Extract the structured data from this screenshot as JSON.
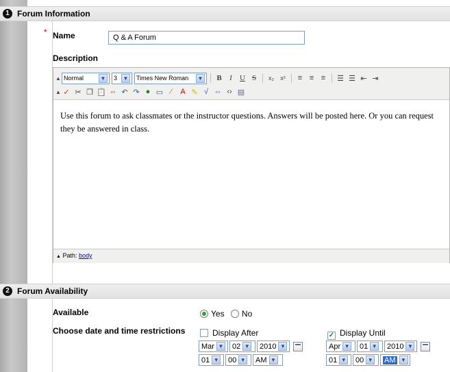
{
  "section1": {
    "number": "1",
    "title": "Forum Information"
  },
  "name_field": {
    "required_mark": "*",
    "label": "Name",
    "value": "Q & A Forum"
  },
  "description": {
    "label": "Description"
  },
  "editor": {
    "format_select": "Normal",
    "size_select": "3",
    "font_select": "Times New Roman",
    "body_text": "Use this forum to ask classmates or the instructor questions.  Answers will be posted here.  Or you can request they be answered in class.",
    "path_label": "Path:",
    "path_link": "body"
  },
  "section2": {
    "number": "2",
    "title": "Forum Availability"
  },
  "available": {
    "label": "Available",
    "yes": "Yes",
    "no": "No",
    "selected": "Yes"
  },
  "restrictions": {
    "label": "Choose date and time restrictions",
    "display_after": {
      "label": "Display After",
      "checked": false,
      "month": "Mar",
      "day": "02",
      "year": "2010",
      "hour": "01",
      "minute": "00",
      "ampm": "AM"
    },
    "display_until": {
      "label": "Display Until",
      "checked": true,
      "month": "Apr",
      "day": "01",
      "year": "2010",
      "hour": "01",
      "minute": "00",
      "ampm": "AM"
    }
  },
  "colors": {
    "accent_radio": "#2fa12f",
    "link": "#0000cc",
    "selection": "#316ac5"
  }
}
